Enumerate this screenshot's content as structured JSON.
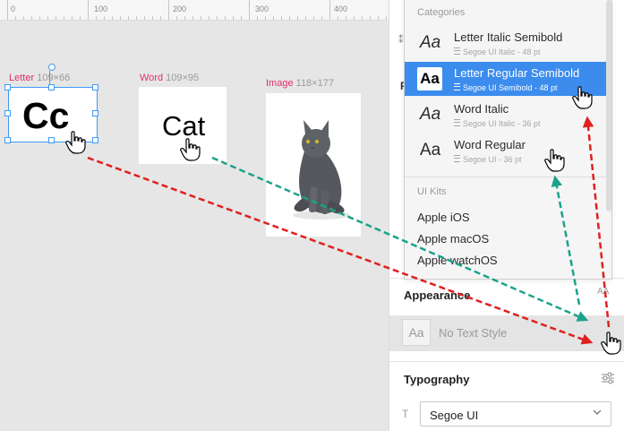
{
  "canvas": {
    "ruler_marks": [
      "0",
      "100",
      "200",
      "300",
      "400"
    ],
    "artboards": {
      "letter": {
        "name": "Letter",
        "size": "109×66",
        "content": "Cc"
      },
      "word": {
        "name": "Word",
        "size": "109×95",
        "content": "Cat"
      },
      "image": {
        "name": "Image",
        "size": "118×177",
        "content": "cat-photo"
      }
    }
  },
  "dropdown": {
    "categories_label": "Categories",
    "text_styles": [
      {
        "preview": "Aa",
        "name": "Letter Italic Semibold",
        "meta": "Segoe UI Italic - 48 pt",
        "selected": false
      },
      {
        "preview": "Aa",
        "name": "Letter Regular Semibold",
        "meta": "Segoe UI Semibold - 48 pt",
        "selected": true
      },
      {
        "preview": "Aa",
        "name": "Word Italic",
        "meta": "Segoe UI Italic - 36 pt",
        "selected": false
      },
      {
        "preview": "Aa",
        "name": "Word Regular",
        "meta": "Segoe UI  - 36 pt",
        "selected": false
      }
    ],
    "ui_kits_label": "UI Kits",
    "ui_kits": [
      "Apple iOS",
      "Apple macOS",
      "Apple watchOS"
    ]
  },
  "panel": {
    "edge_text": "F",
    "appearance": {
      "title": "Appearance",
      "icon_text": "AA",
      "preview": "Aa",
      "no_style_label": "No Text Style"
    },
    "typography": {
      "title": "Typography",
      "font_icon": "T",
      "font_value": "Segoe UI"
    }
  },
  "annotations": {
    "red_color": "#e0201f",
    "teal_color": "#1aa38a",
    "selection_color": "#3b8ced"
  }
}
